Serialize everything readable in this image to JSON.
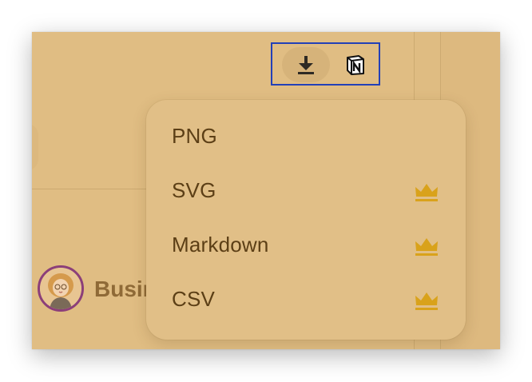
{
  "toolbar": {
    "download_icon": "download-icon",
    "notion_icon": "notion-icon"
  },
  "user": {
    "name": "Busin"
  },
  "export_menu": {
    "items": [
      {
        "label": "PNG",
        "premium": false
      },
      {
        "label": "SVG",
        "premium": true
      },
      {
        "label": "Markdown",
        "premium": true
      },
      {
        "label": "CSV",
        "premium": true
      }
    ]
  },
  "colors": {
    "background": "#e0bd83",
    "menu_text": "#5c3f16",
    "crown": "#d9a21b",
    "highlight_border": "#2340b8",
    "avatar_ring": "#8c3f79"
  }
}
